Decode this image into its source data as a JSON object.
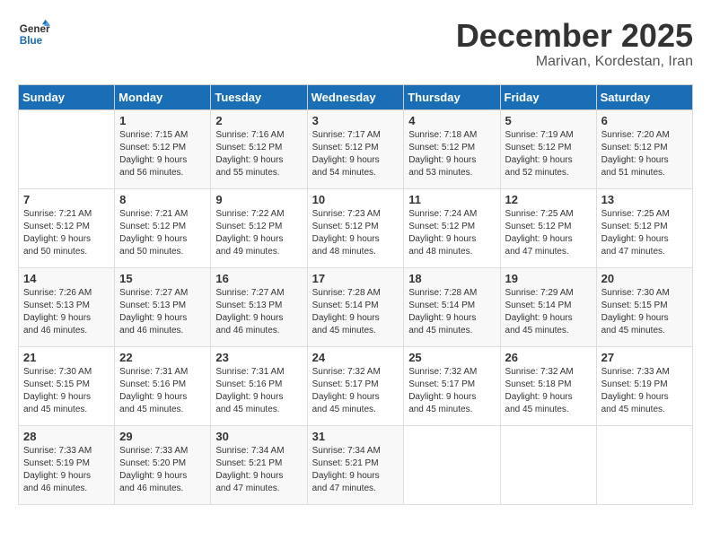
{
  "logo": {
    "line1": "General",
    "line2": "Blue"
  },
  "title": "December 2025",
  "subtitle": "Marivan, Kordestan, Iran",
  "days_header": [
    "Sunday",
    "Monday",
    "Tuesday",
    "Wednesday",
    "Thursday",
    "Friday",
    "Saturday"
  ],
  "weeks": [
    [
      {
        "day": "",
        "info": ""
      },
      {
        "day": "1",
        "info": "Sunrise: 7:15 AM\nSunset: 5:12 PM\nDaylight: 9 hours\nand 56 minutes."
      },
      {
        "day": "2",
        "info": "Sunrise: 7:16 AM\nSunset: 5:12 PM\nDaylight: 9 hours\nand 55 minutes."
      },
      {
        "day": "3",
        "info": "Sunrise: 7:17 AM\nSunset: 5:12 PM\nDaylight: 9 hours\nand 54 minutes."
      },
      {
        "day": "4",
        "info": "Sunrise: 7:18 AM\nSunset: 5:12 PM\nDaylight: 9 hours\nand 53 minutes."
      },
      {
        "day": "5",
        "info": "Sunrise: 7:19 AM\nSunset: 5:12 PM\nDaylight: 9 hours\nand 52 minutes."
      },
      {
        "day": "6",
        "info": "Sunrise: 7:20 AM\nSunset: 5:12 PM\nDaylight: 9 hours\nand 51 minutes."
      }
    ],
    [
      {
        "day": "7",
        "info": "Sunrise: 7:21 AM\nSunset: 5:12 PM\nDaylight: 9 hours\nand 50 minutes."
      },
      {
        "day": "8",
        "info": "Sunrise: 7:21 AM\nSunset: 5:12 PM\nDaylight: 9 hours\nand 50 minutes."
      },
      {
        "day": "9",
        "info": "Sunrise: 7:22 AM\nSunset: 5:12 PM\nDaylight: 9 hours\nand 49 minutes."
      },
      {
        "day": "10",
        "info": "Sunrise: 7:23 AM\nSunset: 5:12 PM\nDaylight: 9 hours\nand 48 minutes."
      },
      {
        "day": "11",
        "info": "Sunrise: 7:24 AM\nSunset: 5:12 PM\nDaylight: 9 hours\nand 48 minutes."
      },
      {
        "day": "12",
        "info": "Sunrise: 7:25 AM\nSunset: 5:12 PM\nDaylight: 9 hours\nand 47 minutes."
      },
      {
        "day": "13",
        "info": "Sunrise: 7:25 AM\nSunset: 5:12 PM\nDaylight: 9 hours\nand 47 minutes."
      }
    ],
    [
      {
        "day": "14",
        "info": "Sunrise: 7:26 AM\nSunset: 5:13 PM\nDaylight: 9 hours\nand 46 minutes."
      },
      {
        "day": "15",
        "info": "Sunrise: 7:27 AM\nSunset: 5:13 PM\nDaylight: 9 hours\nand 46 minutes."
      },
      {
        "day": "16",
        "info": "Sunrise: 7:27 AM\nSunset: 5:13 PM\nDaylight: 9 hours\nand 46 minutes."
      },
      {
        "day": "17",
        "info": "Sunrise: 7:28 AM\nSunset: 5:14 PM\nDaylight: 9 hours\nand 45 minutes."
      },
      {
        "day": "18",
        "info": "Sunrise: 7:28 AM\nSunset: 5:14 PM\nDaylight: 9 hours\nand 45 minutes."
      },
      {
        "day": "19",
        "info": "Sunrise: 7:29 AM\nSunset: 5:14 PM\nDaylight: 9 hours\nand 45 minutes."
      },
      {
        "day": "20",
        "info": "Sunrise: 7:30 AM\nSunset: 5:15 PM\nDaylight: 9 hours\nand 45 minutes."
      }
    ],
    [
      {
        "day": "21",
        "info": "Sunrise: 7:30 AM\nSunset: 5:15 PM\nDaylight: 9 hours\nand 45 minutes."
      },
      {
        "day": "22",
        "info": "Sunrise: 7:31 AM\nSunset: 5:16 PM\nDaylight: 9 hours\nand 45 minutes."
      },
      {
        "day": "23",
        "info": "Sunrise: 7:31 AM\nSunset: 5:16 PM\nDaylight: 9 hours\nand 45 minutes."
      },
      {
        "day": "24",
        "info": "Sunrise: 7:32 AM\nSunset: 5:17 PM\nDaylight: 9 hours\nand 45 minutes."
      },
      {
        "day": "25",
        "info": "Sunrise: 7:32 AM\nSunset: 5:17 PM\nDaylight: 9 hours\nand 45 minutes."
      },
      {
        "day": "26",
        "info": "Sunrise: 7:32 AM\nSunset: 5:18 PM\nDaylight: 9 hours\nand 45 minutes."
      },
      {
        "day": "27",
        "info": "Sunrise: 7:33 AM\nSunset: 5:19 PM\nDaylight: 9 hours\nand 45 minutes."
      }
    ],
    [
      {
        "day": "28",
        "info": "Sunrise: 7:33 AM\nSunset: 5:19 PM\nDaylight: 9 hours\nand 46 minutes."
      },
      {
        "day": "29",
        "info": "Sunrise: 7:33 AM\nSunset: 5:20 PM\nDaylight: 9 hours\nand 46 minutes."
      },
      {
        "day": "30",
        "info": "Sunrise: 7:34 AM\nSunset: 5:21 PM\nDaylight: 9 hours\nand 47 minutes."
      },
      {
        "day": "31",
        "info": "Sunrise: 7:34 AM\nSunset: 5:21 PM\nDaylight: 9 hours\nand 47 minutes."
      },
      {
        "day": "",
        "info": ""
      },
      {
        "day": "",
        "info": ""
      },
      {
        "day": "",
        "info": ""
      }
    ]
  ]
}
